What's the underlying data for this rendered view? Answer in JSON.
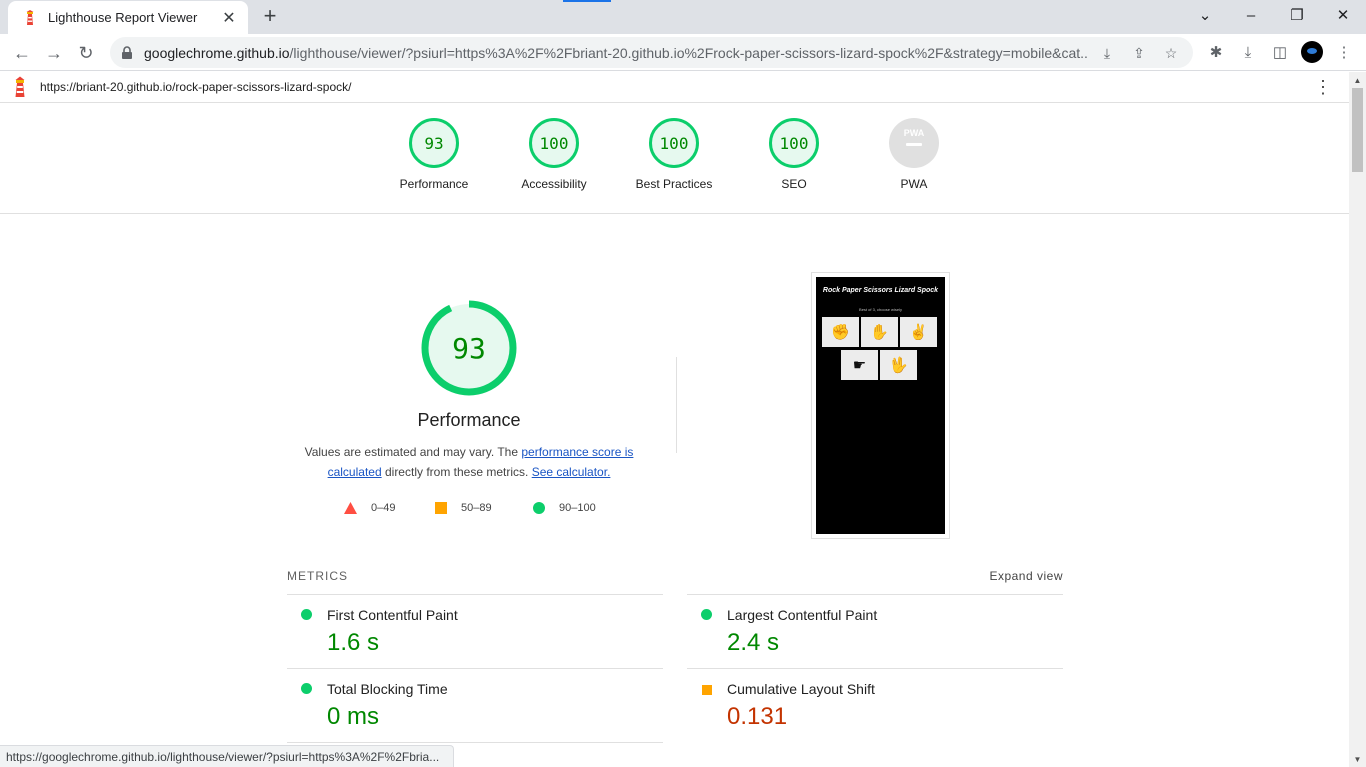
{
  "browser": {
    "tab_title": "Lighthouse Report Viewer",
    "tab_close": "✕",
    "new_tab": "+",
    "url_host": "googlechrome.github.io",
    "url_rest": "/lighthouse/viewer/?psiurl=https%3A%2F%2Fbriant-20.github.io%2Frock-paper-scissors-lizard-spock%2F&strategy=mobile&cat...",
    "status_url": "https://googlechrome.github.io/lighthouse/viewer/?psiurl=https%3A%2F%2Fbria..."
  },
  "lh_topbar": {
    "url": "https://briant-20.github.io/rock-paper-scissors-lizard-spock/",
    "menu": "⋮"
  },
  "categories": [
    {
      "score": "93",
      "label": "Performance"
    },
    {
      "score": "100",
      "label": "Accessibility"
    },
    {
      "score": "100",
      "label": "Best Practices"
    },
    {
      "score": "100",
      "label": "SEO"
    },
    {
      "score": "PWA",
      "label": "PWA"
    }
  ],
  "performance": {
    "score": "93",
    "score_fraction": 0.93,
    "title": "Performance",
    "desc_1": "Values are estimated and may vary. The ",
    "desc_link_1": "performance score is calculated",
    "desc_2": " directly from these metrics. ",
    "desc_link_2": "See calculator."
  },
  "legend": {
    "fail": "0–49",
    "average": "50–89",
    "pass": "90–100"
  },
  "screenshot": {
    "title": "Rock Paper Scissors Lizard Spock",
    "subtitle": "Best of 3, choose wisely"
  },
  "metrics": {
    "heading": "METRICS",
    "expand": "Expand view",
    "fcp": {
      "label": "First Contentful Paint",
      "value": "1.6 s"
    },
    "lcp": {
      "label": "Largest Contentful Paint",
      "value": "2.4 s"
    },
    "tbt": {
      "label": "Total Blocking Time",
      "value": "0 ms"
    },
    "cls": {
      "label": "Cumulative Layout Shift",
      "value": "0.131"
    }
  },
  "colors": {
    "pass": "#0cce6b",
    "average": "#ffa400",
    "fail": "#ff4e42",
    "pass_text": "#008800",
    "average_text": "#c33300"
  }
}
